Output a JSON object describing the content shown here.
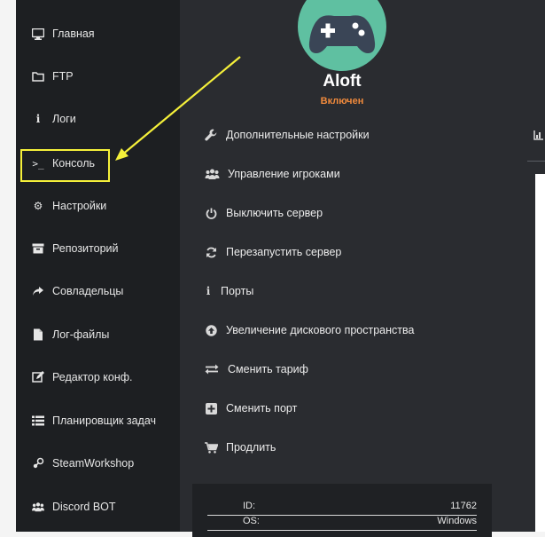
{
  "sidebar": {
    "items": [
      {
        "label": "Главная",
        "icon": "monitor-icon"
      },
      {
        "label": "FTP",
        "icon": "folder-icon"
      },
      {
        "label": "Логи",
        "icon": "info-icon"
      },
      {
        "label": "Консоль",
        "icon": "terminal-icon"
      },
      {
        "label": "Настройки",
        "icon": "gears-icon"
      },
      {
        "label": "Репозиторий",
        "icon": "archive-icon"
      },
      {
        "label": "Совладельцы",
        "icon": "share-icon"
      },
      {
        "label": "Лог-файлы",
        "icon": "file-icon"
      },
      {
        "label": "Редактор конф.",
        "icon": "edit-icon"
      },
      {
        "label": "Планировщик задач",
        "icon": "list-icon"
      },
      {
        "label": "SteamWorkshop",
        "icon": "steam-icon"
      },
      {
        "label": "Discord BOT",
        "icon": "users-icon"
      }
    ]
  },
  "server": {
    "name": "Aloft",
    "status": "Включен",
    "avatar_icon": "gamepad-icon"
  },
  "menu": {
    "items": [
      {
        "label": "Дополнительные настройки",
        "icon": "wrench-icon"
      },
      {
        "label": "Управление игроками",
        "icon": "users-icon"
      },
      {
        "label": "Выключить сервер",
        "icon": "power-icon"
      },
      {
        "label": "Перезапустить сервер",
        "icon": "refresh-icon"
      },
      {
        "label": "Порты",
        "icon": "info-icon"
      },
      {
        "label": "Увеличение дискового пространства",
        "icon": "arrow-up-circle-icon"
      },
      {
        "label": "Сменить тариф",
        "icon": "exchange-icon"
      },
      {
        "label": "Сменить порт",
        "icon": "plus-square-icon"
      },
      {
        "label": "Продлить",
        "icon": "cart-icon"
      }
    ]
  },
  "info": {
    "rows": [
      {
        "key": "ID:",
        "value": "11762"
      },
      {
        "key": "OS:",
        "value": "Windows"
      }
    ]
  },
  "colors": {
    "sidebar_bg": "#1d1f22",
    "main_bg": "#2a2c30",
    "status": "#f08a3c",
    "avatar": "#5fc0a1",
    "highlight": "#f5f03a"
  }
}
